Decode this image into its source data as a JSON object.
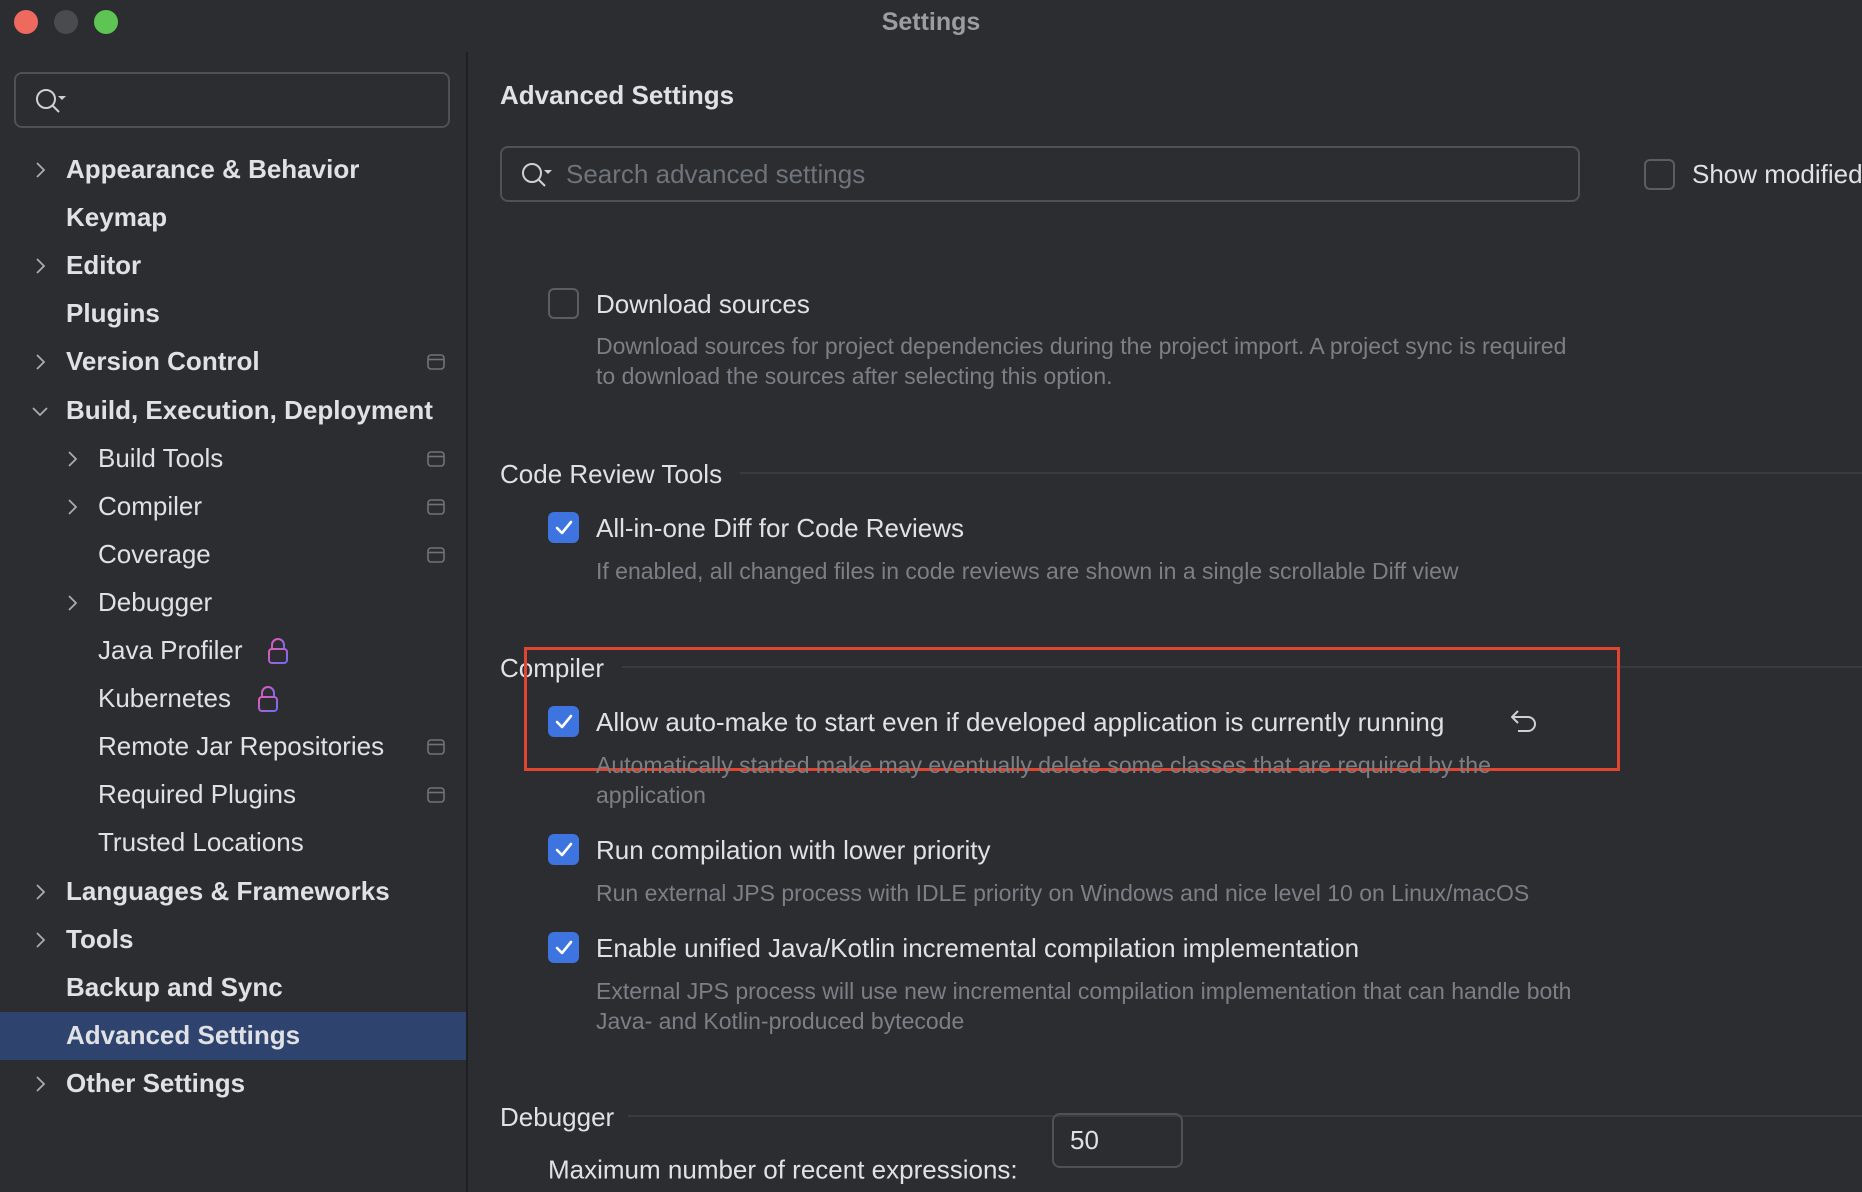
{
  "window": {
    "title": "Settings"
  },
  "sidebar": {
    "search": {
      "placeholder": "",
      "value": ""
    },
    "items": [
      {
        "label": "Appearance & Behavior",
        "level": 0,
        "bold": true,
        "expandable": true,
        "expanded": false
      },
      {
        "label": "Keymap",
        "level": 0,
        "bold": true,
        "expandable": false
      },
      {
        "label": "Editor",
        "level": 0,
        "bold": true,
        "expandable": true,
        "expanded": false
      },
      {
        "label": "Plugins",
        "level": 0,
        "bold": true,
        "expandable": false
      },
      {
        "label": "Version Control",
        "level": 0,
        "bold": true,
        "expandable": true,
        "expanded": false,
        "project_icon": true
      },
      {
        "label": "Build, Execution, Deployment",
        "level": 0,
        "bold": true,
        "expandable": true,
        "expanded": true
      },
      {
        "label": "Build Tools",
        "level": 1,
        "bold": false,
        "expandable": true,
        "expanded": false,
        "project_icon": true
      },
      {
        "label": "Compiler",
        "level": 1,
        "bold": false,
        "expandable": true,
        "expanded": false,
        "project_icon": true
      },
      {
        "label": "Coverage",
        "level": 1,
        "bold": false,
        "expandable": false,
        "project_icon": true
      },
      {
        "label": "Debugger",
        "level": 1,
        "bold": false,
        "expandable": true,
        "expanded": false
      },
      {
        "label": "Java Profiler",
        "level": 1,
        "bold": false,
        "expandable": false,
        "locked": true
      },
      {
        "label": "Kubernetes",
        "level": 1,
        "bold": false,
        "expandable": false,
        "locked": true
      },
      {
        "label": "Remote Jar Repositories",
        "level": 1,
        "bold": false,
        "expandable": false,
        "project_icon": true
      },
      {
        "label": "Required Plugins",
        "level": 1,
        "bold": false,
        "expandable": false,
        "project_icon": true
      },
      {
        "label": "Trusted Locations",
        "level": 1,
        "bold": false,
        "expandable": false
      },
      {
        "label": "Languages & Frameworks",
        "level": 0,
        "bold": true,
        "expandable": true,
        "expanded": false
      },
      {
        "label": "Tools",
        "level": 0,
        "bold": true,
        "expandable": true,
        "expanded": false
      },
      {
        "label": "Backup and Sync",
        "level": 0,
        "bold": true,
        "expandable": false
      },
      {
        "label": "Advanced Settings",
        "level": 0,
        "bold": true,
        "expandable": false,
        "selected": true
      },
      {
        "label": "Other Settings",
        "level": 0,
        "bold": true,
        "expandable": true,
        "expanded": false
      }
    ]
  },
  "main": {
    "title": "Advanced Settings",
    "search": {
      "placeholder": "Search advanced settings",
      "value": ""
    },
    "show_modified": {
      "label": "Show modified",
      "checked": false
    },
    "download_sources": {
      "label": "Download sources",
      "checked": false,
      "description_lines": [
        "Download sources for project dependencies during the project import. A project sync is required",
        "to download the sources after selecting this option."
      ]
    },
    "groups": {
      "code_review": {
        "title": "Code Review Tools",
        "options": [
          {
            "label": "All-in-one Diff for Code Reviews",
            "checked": true,
            "description_lines": [
              "If enabled, all changed files in code reviews are shown in a single scrollable Diff view"
            ]
          }
        ]
      },
      "compiler": {
        "title": "Compiler",
        "options": [
          {
            "label": "Allow auto-make to start even if developed application is currently running",
            "checked": true,
            "modified": true,
            "highlighted": true,
            "description_lines": [
              "Automatically started make may eventually delete some classes that are required by the",
              "application"
            ]
          },
          {
            "label": "Run compilation with lower priority",
            "checked": true,
            "description_lines": [
              "Run external JPS process with IDLE priority on Windows and nice level 10 on Linux/macOS"
            ]
          },
          {
            "label": "Enable unified Java/Kotlin incremental compilation implementation",
            "checked": true,
            "description_lines": [
              "External JPS process will use new incremental compilation implementation that can handle both",
              "Java- and Kotlin-produced bytecode"
            ]
          }
        ]
      },
      "debugger": {
        "title": "Debugger",
        "max_recent_expressions": {
          "label": "Maximum number of recent expressions:",
          "value": "50"
        }
      }
    }
  },
  "colors": {
    "background": "#2b2d30",
    "selection": "#2e436e",
    "accent": "#3d74e0",
    "highlight_border": "#e0452f",
    "lock_gradient_start": "#e75bb5",
    "lock_gradient_end": "#6e6bf5"
  }
}
